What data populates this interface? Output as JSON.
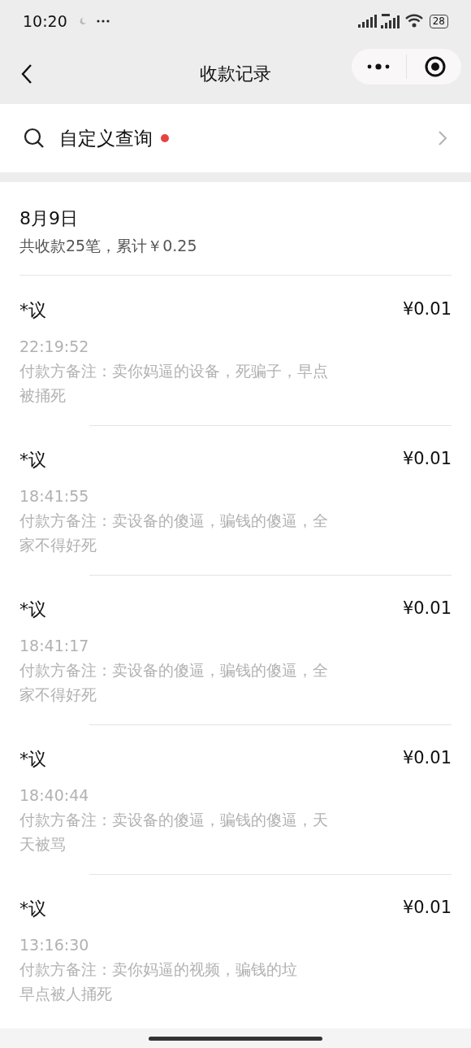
{
  "status_bar": {
    "time": "10:20",
    "battery": "28"
  },
  "nav": {
    "title": "收款记录"
  },
  "search": {
    "label": "自定义查询",
    "badge": true
  },
  "day": {
    "date": "8月9日",
    "summary": "共收款25笔，累计￥0.25"
  },
  "records": [
    {
      "payer": "*议",
      "amount": "¥0.01",
      "time": "22:19:52",
      "remark_lines": [
        "付款方备注：卖你妈逼的设备，死骗子，早点",
        "被捅死"
      ]
    },
    {
      "payer": "*议",
      "amount": "¥0.01",
      "time": "18:41:55",
      "remark_lines": [
        "付款方备注：卖设备的傻逼，骗钱的傻逼，全",
        "家不得好死"
      ]
    },
    {
      "payer": "*议",
      "amount": "¥0.01",
      "time": "18:41:17",
      "remark_lines": [
        "付款方备注：卖设备的傻逼，骗钱的傻逼，全",
        "家不得好死"
      ]
    },
    {
      "payer": "*议",
      "amount": "¥0.01",
      "time": "18:40:44",
      "remark_lines": [
        "付款方备注：卖设备的傻逼，骗钱的傻逼，天",
        "天被骂"
      ]
    },
    {
      "payer": "*议",
      "amount": "¥0.01",
      "time": "13:16:30",
      "remark_lines": [
        "付款方备注：卖你妈逼的视频，骗钱的垃",
        "早点被人捅死"
      ]
    }
  ]
}
